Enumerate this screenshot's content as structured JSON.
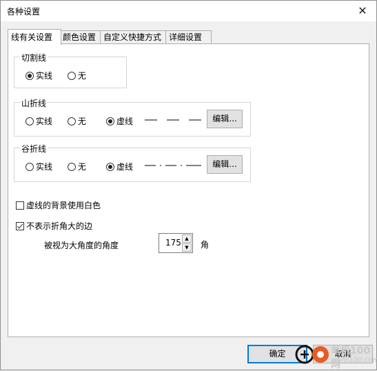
{
  "dialog": {
    "title": "各种设置",
    "close_glyph": "✕"
  },
  "tabs": [
    "线有关设置",
    "颜色设置",
    "自定义快捷方式",
    "详细设置"
  ],
  "cut_line": {
    "title": "切割线",
    "options": [
      "实线",
      "无"
    ],
    "selected": "实线"
  },
  "mountain_fold": {
    "title": "山折线",
    "options": [
      "实线",
      "无",
      "虚线"
    ],
    "selected": "虚线",
    "edit_label": "编辑..."
  },
  "valley_fold": {
    "title": "谷折线",
    "options": [
      "实线",
      "无",
      "虚线"
    ],
    "selected": "虚线",
    "edit_label": "编辑..."
  },
  "options": {
    "dashed_white_bg": {
      "label": "虚线的背景使用白色",
      "checked": false
    },
    "hide_large_angle": {
      "label": "不表示折角大的边",
      "checked": true
    }
  },
  "angle": {
    "label": "被视为大角度的角度",
    "value": "175",
    "unit": "角"
  },
  "footer": {
    "ok_label": "确定",
    "cancel_label": "取消"
  },
  "watermark": {
    "text_cn": "单机100网",
    "text_en": "danji100.com"
  }
}
